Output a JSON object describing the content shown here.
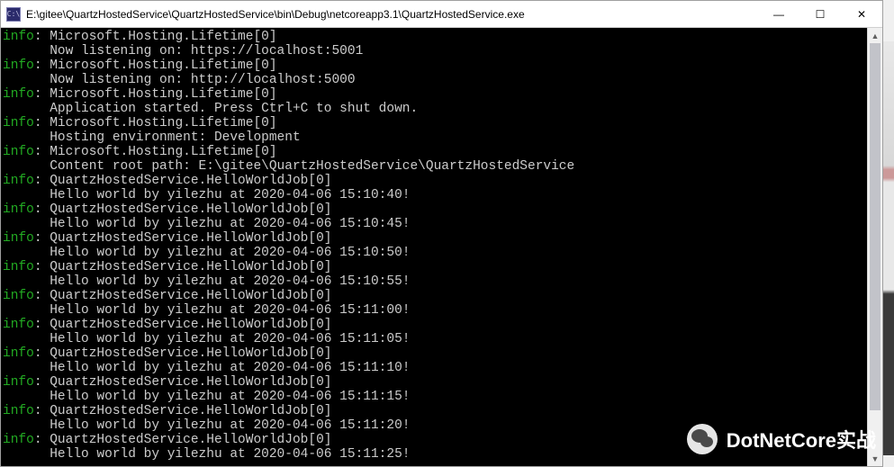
{
  "window": {
    "icon_text": "C:\\",
    "title": "E:\\gitee\\QuartzHostedService\\QuartzHostedService\\bin\\Debug\\netcoreapp3.1\\QuartzHostedService.exe",
    "buttons": {
      "minimize": "—",
      "maximize": "☐",
      "close": "✕"
    }
  },
  "log": {
    "level_label": "info",
    "entries": [
      {
        "src": "Microsoft.Hosting.Lifetime[0]",
        "msg": "Now listening on: https://localhost:5001"
      },
      {
        "src": "Microsoft.Hosting.Lifetime[0]",
        "msg": "Now listening on: http://localhost:5000"
      },
      {
        "src": "Microsoft.Hosting.Lifetime[0]",
        "msg": "Application started. Press Ctrl+C to shut down."
      },
      {
        "src": "Microsoft.Hosting.Lifetime[0]",
        "msg": "Hosting environment: Development"
      },
      {
        "src": "Microsoft.Hosting.Lifetime[0]",
        "msg": "Content root path: E:\\gitee\\QuartzHostedService\\QuartzHostedService"
      },
      {
        "src": "QuartzHostedService.HelloWorldJob[0]",
        "msg": "Hello world by yilezhu at 2020-04-06 15:10:40!"
      },
      {
        "src": "QuartzHostedService.HelloWorldJob[0]",
        "msg": "Hello world by yilezhu at 2020-04-06 15:10:45!"
      },
      {
        "src": "QuartzHostedService.HelloWorldJob[0]",
        "msg": "Hello world by yilezhu at 2020-04-06 15:10:50!"
      },
      {
        "src": "QuartzHostedService.HelloWorldJob[0]",
        "msg": "Hello world by yilezhu at 2020-04-06 15:10:55!"
      },
      {
        "src": "QuartzHostedService.HelloWorldJob[0]",
        "msg": "Hello world by yilezhu at 2020-04-06 15:11:00!"
      },
      {
        "src": "QuartzHostedService.HelloWorldJob[0]",
        "msg": "Hello world by yilezhu at 2020-04-06 15:11:05!"
      },
      {
        "src": "QuartzHostedService.HelloWorldJob[0]",
        "msg": "Hello world by yilezhu at 2020-04-06 15:11:10!"
      },
      {
        "src": "QuartzHostedService.HelloWorldJob[0]",
        "msg": "Hello world by yilezhu at 2020-04-06 15:11:15!"
      },
      {
        "src": "QuartzHostedService.HelloWorldJob[0]",
        "msg": "Hello world by yilezhu at 2020-04-06 15:11:20!"
      },
      {
        "src": "QuartzHostedService.HelloWorldJob[0]",
        "msg": "Hello world by yilezhu at 2020-04-06 15:11:25!"
      }
    ]
  },
  "watermark": {
    "text": "DotNetCore实战"
  },
  "scrollbar": {
    "up": "▲",
    "down": "▼"
  }
}
